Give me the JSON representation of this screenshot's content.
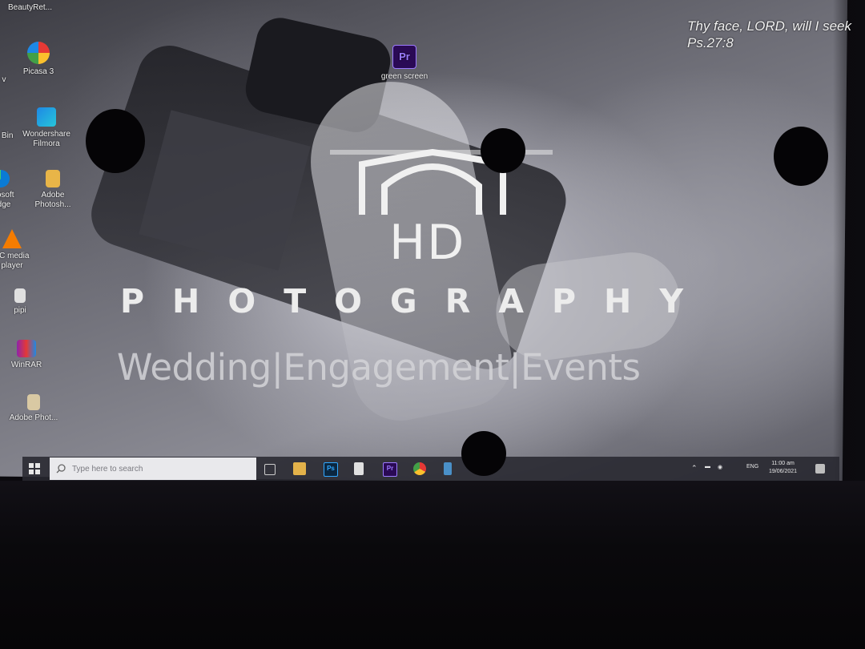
{
  "desktop": {
    "top_label": "BeautyRet...",
    "verse_line1": "Thy face, LORD, will I seek",
    "verse_line2": "Ps.27:8",
    "icons": [
      {
        "label": "v",
        "icon": "edge-fragment-icon"
      },
      {
        "label": "Picasa 3",
        "icon": "picasa-icon"
      },
      {
        "label": "green screen",
        "icon": "premiere-icon"
      },
      {
        "label": "e Bin",
        "icon": "recycle-bin-icon"
      },
      {
        "label": "Wondershare",
        "label2": "Filmora",
        "icon": "filmora-icon"
      },
      {
        "label": "rosoft",
        "label2": "dge",
        "icon": "edge-icon"
      },
      {
        "label": "Adobe",
        "label2": "Photosh...",
        "icon": "folder-icon"
      },
      {
        "label": "LC media",
        "label2": "player",
        "icon": "vlc-icon"
      },
      {
        "label": "pipi",
        "icon": "file-icon"
      },
      {
        "label": "WinRAR",
        "icon": "winrar-icon"
      },
      {
        "label": "Adobe Phot...",
        "icon": "document-icon"
      }
    ]
  },
  "wallpaper": {
    "logo_mark": "HD",
    "title": "PHOTOGRAPHY",
    "tagline": "Wedding|Engagement|Events"
  },
  "taskbar": {
    "search_placeholder": "Type here to search",
    "tray_language": "ENG",
    "time": "11:00 am",
    "date": "19/06/2021"
  },
  "colors": {
    "taskbar": "#2a2a32",
    "text": "#f2f2f2",
    "premiere": "#2a0a55",
    "premiere_text": "#9b7bff"
  }
}
